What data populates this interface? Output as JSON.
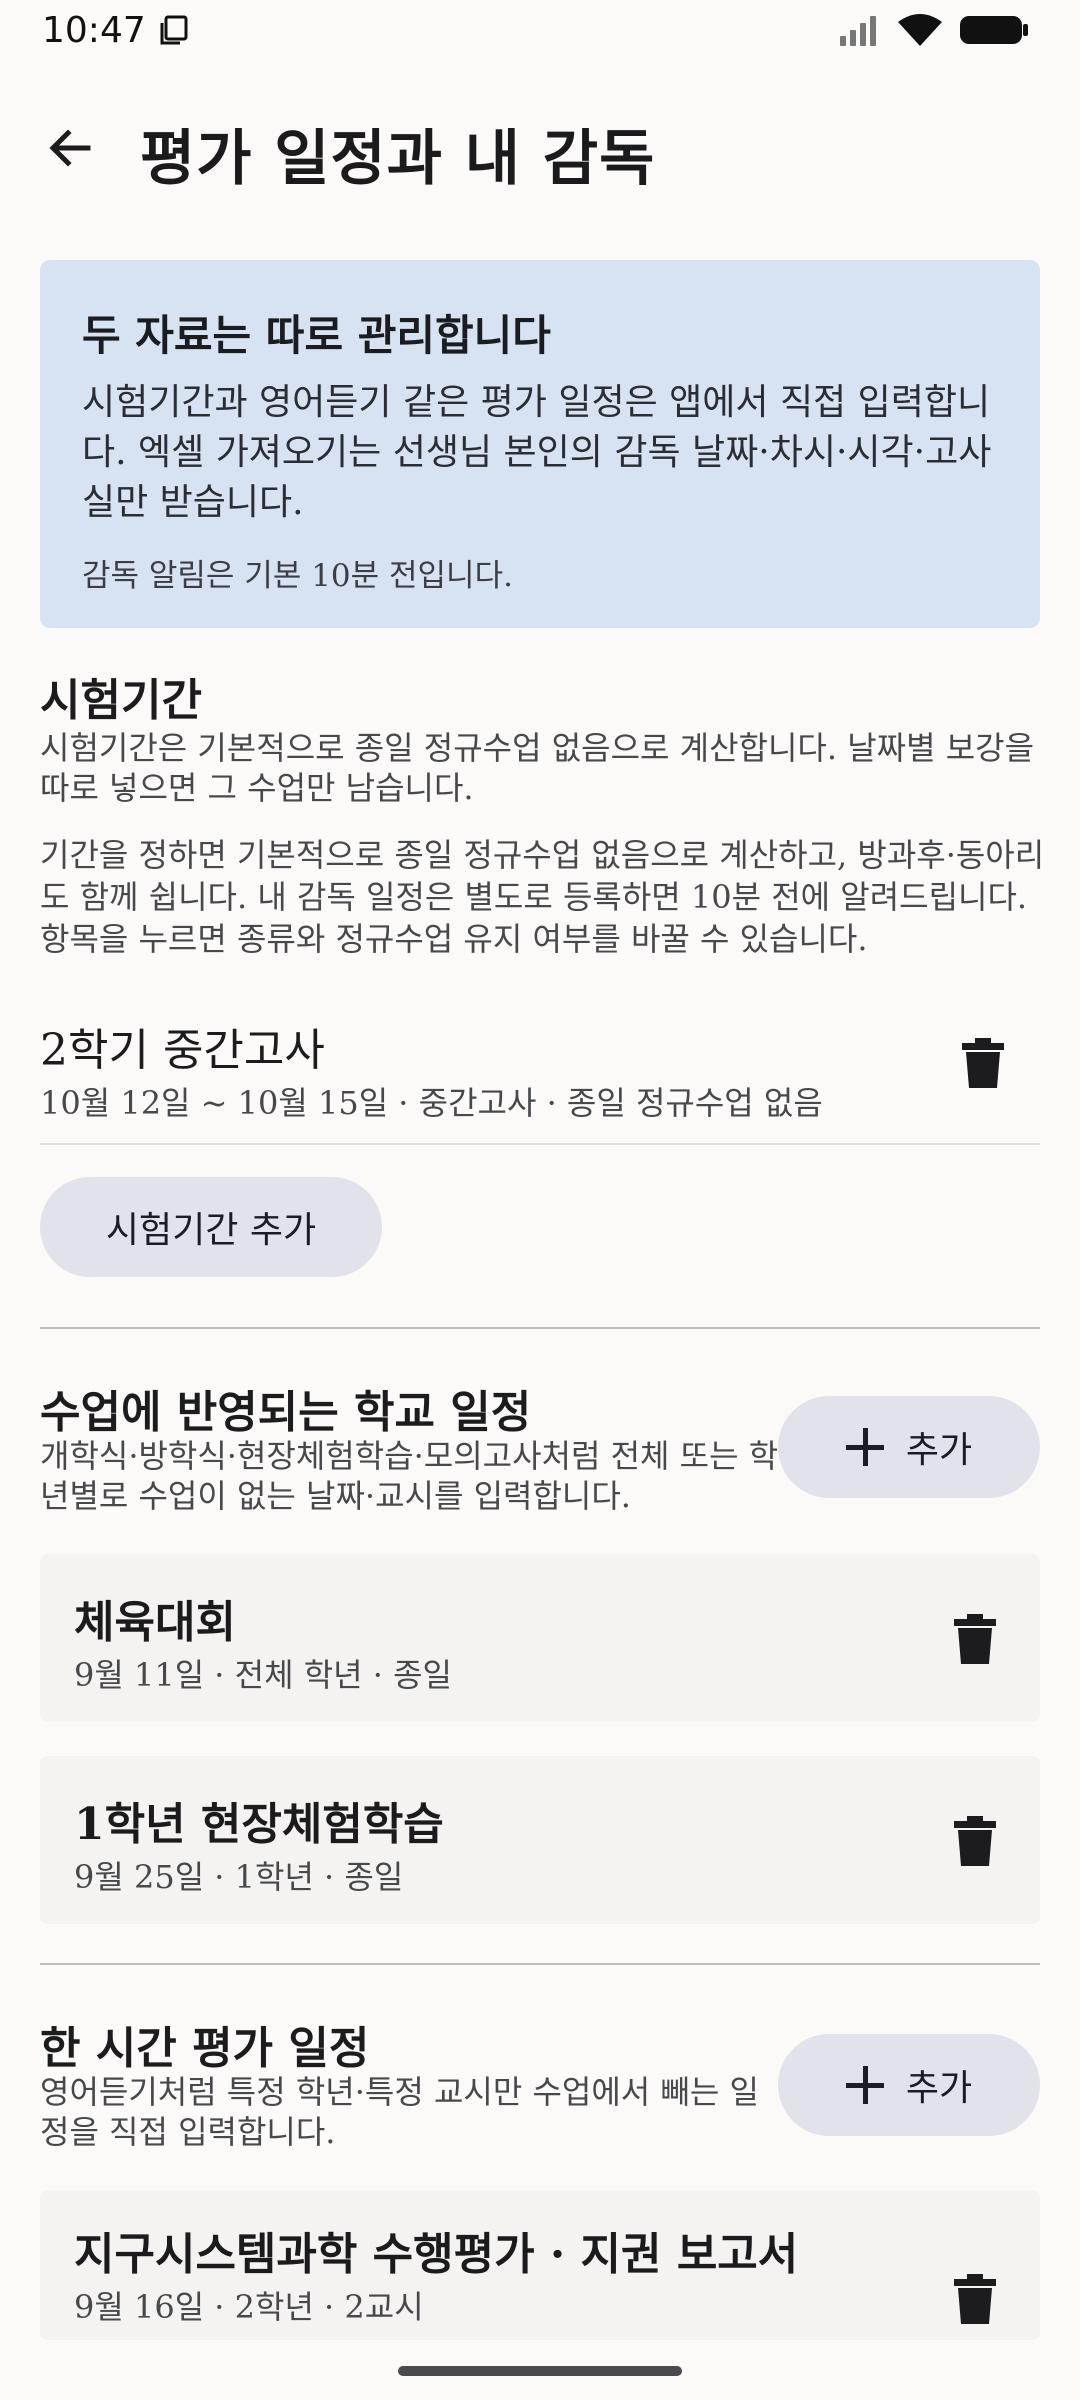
{
  "status_bar": {
    "time": "10:47"
  },
  "app_bar": {
    "title": "평가 일정과 내 감독"
  },
  "info_card": {
    "title": "두 자료는 따로 관리합니다",
    "body": "시험기간과 영어듣기 같은 평가 일정은 앱에서 직접 입력합니다. 엑셀 가져오기는 선생님 본인의 감독 날짜·차시·시각·고사실만 받습니다.",
    "note": "감독 알림은 기본 10분 전입니다."
  },
  "exam_period": {
    "heading": "시험기간",
    "desc1": "시험기간은 기본적으로 종일 정규수업 없음으로 계산합니다. 날짜별 보강을 따로 넣으면 그 수업만 남습니다.",
    "desc2": "기간을 정하면 기본적으로 종일 정규수업 없음으로 계산하고, 방과후·동아리도 함께 쉽니다. 내 감독 일정은 별도로 등록하면 10분 전에 알려드립니다. 항목을 누르면 종류와 정규수업 유지 여부를 바꿀 수 있습니다.",
    "items": [
      {
        "title": "2학기 중간고사",
        "subtitle": "10월 12일 ~ 10월 15일 · 중간고사 · 종일 정규수업 없음"
      }
    ],
    "add_label": "시험기간 추가"
  },
  "school_events": {
    "heading": "수업에 반영되는 학교 일정",
    "desc": "개학식·방학식·현장체험학습·모의고사처럼 전체 또는 학년별로 수업이 없는 날짜·교시를 입력합니다.",
    "add_label": "추가",
    "items": [
      {
        "title": "체육대회",
        "subtitle": "9월 11일 · 전체 학년 · 종일"
      },
      {
        "title": "1학년 현장체험학습",
        "subtitle": "9월 25일 · 1학년 · 종일"
      }
    ]
  },
  "single_period": {
    "heading": "한 시간 평가 일정",
    "desc": "영어듣기처럼 특정 학년·특정 교시만 수업에서 빼는 일정을 직접 입력합니다.",
    "add_label": "추가",
    "items": [
      {
        "title": "지구시스템과학 수행평가 · 지권 보고서",
        "subtitle": "9월 16일 · 2학년 · 2교시"
      }
    ]
  },
  "icons": {
    "back": "arrow-left-icon",
    "trash": "trash-icon",
    "add": "plus-icon"
  }
}
